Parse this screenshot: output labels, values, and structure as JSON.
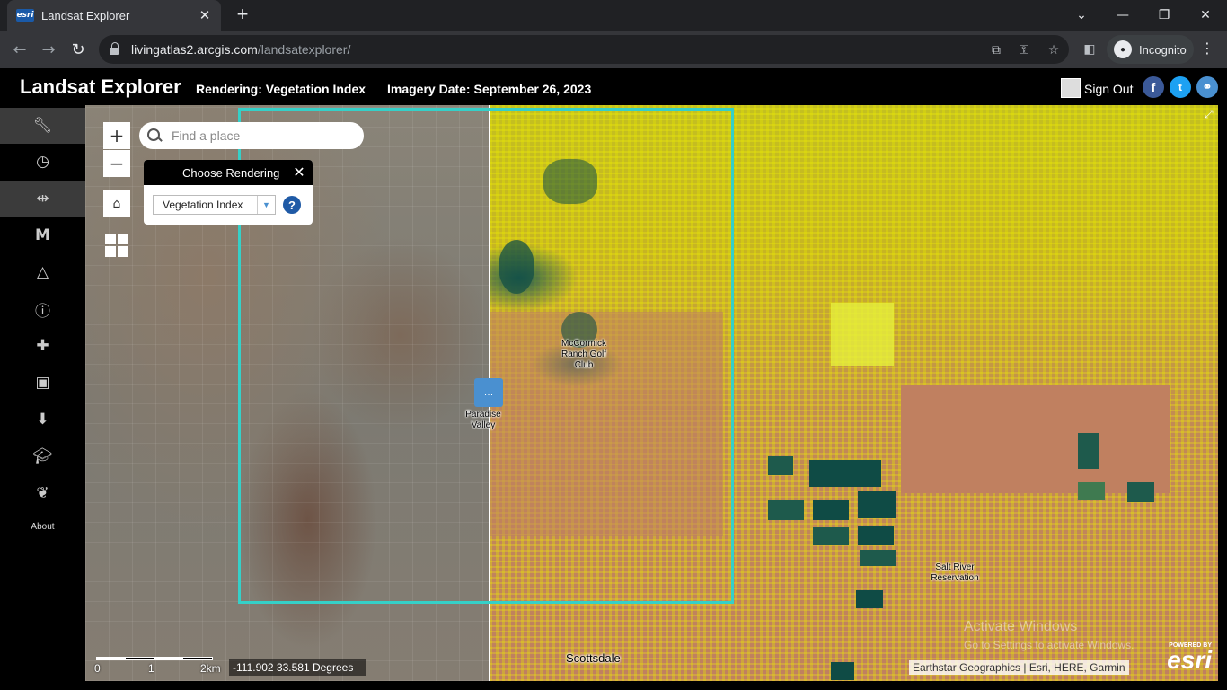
{
  "browser": {
    "tab_title": "Landsat Explorer",
    "favicon_text": "esri",
    "url_host": "livingatlas2.arcgis.com",
    "url_path": "/landsatexplorer/",
    "incognito_label": "Incognito"
  },
  "header": {
    "title": "Landsat Explorer",
    "rendering": "Rendering: Vegetation Index",
    "imagery_date": "Imagery Date: September 26, 2023",
    "sign_out": "Sign Out"
  },
  "sidebar": {
    "items": [
      {
        "icon": "wrench-icon",
        "active": true
      },
      {
        "icon": "clock-icon",
        "active": false
      },
      {
        "icon": "swipe-icon",
        "active": true
      },
      {
        "icon": "m-icon",
        "active": false
      },
      {
        "icon": "triangle-icon",
        "active": false
      },
      {
        "icon": "info-icon",
        "active": false
      },
      {
        "icon": "book-add-icon",
        "active": false
      },
      {
        "icon": "save-icon",
        "active": false
      },
      {
        "icon": "download-icon",
        "active": false
      },
      {
        "icon": "graduation-icon",
        "active": false
      },
      {
        "icon": "leaf-icon",
        "active": false
      }
    ],
    "about_label": "About"
  },
  "map": {
    "search_placeholder": "Find a place",
    "render_panel_title": "Choose Rendering",
    "render_select_value": "Vegetation Index",
    "labels": {
      "mccormick": "McCormick Ranch Golf Club",
      "paradise": "Paradise Valley",
      "scottsdale": "Scottsdale",
      "salt_river": "Salt River Reservation"
    },
    "scale": {
      "zero": "0",
      "one": "1",
      "two": "2km"
    },
    "coordinates": "-111.902 33.581 Degrees",
    "attribution": "Earthstar Geographics | Esri, HERE, Garmin",
    "esri_powered": "POWERED BY",
    "esri_word": "esri",
    "watermark_title": "Activate Windows",
    "watermark_sub": "Go to Settings to activate Windows."
  },
  "colors": {
    "aoi_border": "#35d0c8",
    "vegetation_dark": "#1e5a4c",
    "bare": "#c08060",
    "sparse": "#d4d020"
  }
}
